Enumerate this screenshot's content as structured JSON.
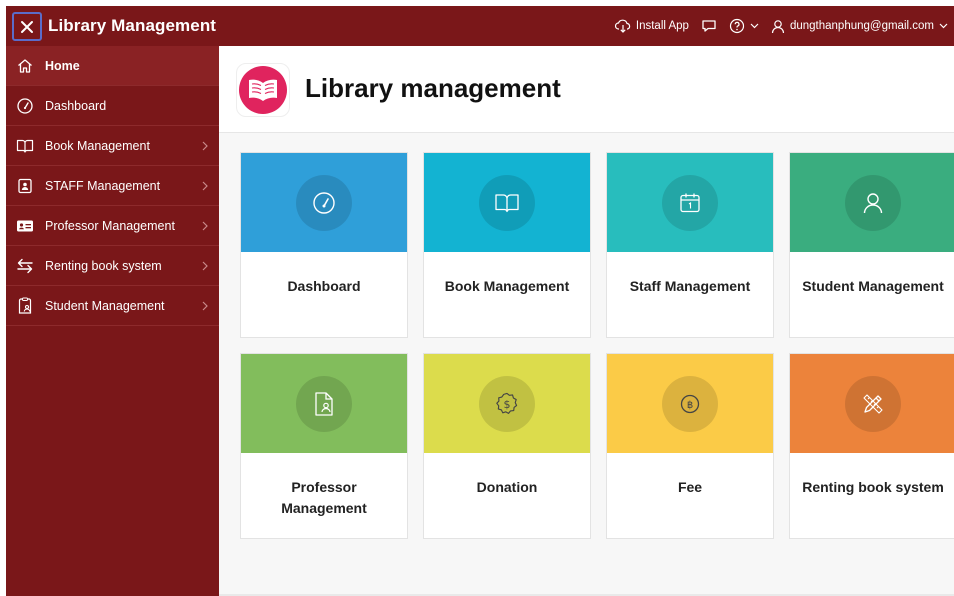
{
  "header": {
    "title": "Library Management",
    "install_label": "Install App",
    "user_email": "dungthanphung@gmail.com"
  },
  "sidebar": {
    "items": [
      {
        "label": "Home",
        "icon": "home-icon"
      },
      {
        "label": "Dashboard",
        "icon": "gauge-icon"
      },
      {
        "label": "Book Management",
        "icon": "book-icon"
      },
      {
        "label": "STAFF Management",
        "icon": "staff-icon"
      },
      {
        "label": "Professor Management",
        "icon": "id-card-icon"
      },
      {
        "label": "Renting book system",
        "icon": "swap-icon"
      },
      {
        "label": "Student Management",
        "icon": "student-icon"
      }
    ]
  },
  "main": {
    "title": "Library management",
    "cards": [
      {
        "label": "Dashboard",
        "color": "#2f9fd9",
        "icon": "gauge-icon"
      },
      {
        "label": "Book Management",
        "color": "#13b3d2",
        "icon": "book-icon"
      },
      {
        "label": "Staff Management",
        "color": "#28bdbd",
        "icon": "calendar-icon"
      },
      {
        "label": "Student Management",
        "color": "#3aad7f",
        "icon": "user-icon"
      },
      {
        "label": "Professor Management",
        "color": "#82bd5c",
        "icon": "file-user-icon"
      },
      {
        "label": "Donation",
        "color": "#dcdc4c",
        "icon": "donation-icon"
      },
      {
        "label": "Fee",
        "color": "#fbcb47",
        "icon": "coin-icon"
      },
      {
        "label": "Renting book system",
        "color": "#ec833b",
        "icon": "pencil-ruler-icon"
      }
    ]
  },
  "colors": {
    "brand": "#7a1719",
    "logo": "#e0245e"
  }
}
